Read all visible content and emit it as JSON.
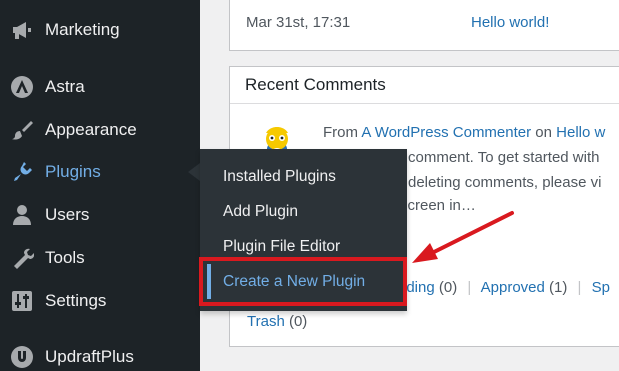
{
  "sidebar": {
    "items": [
      {
        "label": "Marketing",
        "icon": "megaphone-icon"
      },
      {
        "label": "Astra",
        "icon": "astra-logo-icon"
      },
      {
        "label": "Appearance",
        "icon": "paintbrush-icon"
      },
      {
        "label": "Plugins",
        "icon": "plugin-icon"
      },
      {
        "label": "Users",
        "icon": "user-icon"
      },
      {
        "label": "Tools",
        "icon": "wrench-icon"
      },
      {
        "label": "Settings",
        "icon": "settings-sliders-icon"
      },
      {
        "label": "UpdraftPlus",
        "icon": "updraftplus-icon"
      }
    ],
    "active_color": "#72aee6"
  },
  "activity": {
    "date": "Mar 31st, 17:31",
    "post_title": "Hello world!"
  },
  "recent_comments": {
    "title": "Recent Comments",
    "from_prefix": "From",
    "author": "A WordPress Commenter",
    "on_word": "on",
    "post": "Hello w",
    "line2": "comment. To get started with",
    "line3": "deleting comments, please vi",
    "line4": "screen in…",
    "status_links": {
      "pending": "nding",
      "pending_count": "(0)",
      "approved": "Approved",
      "approved_count": "(1)",
      "spam": "Sp",
      "trash": "Trash",
      "trash_count": "(0)"
    }
  },
  "plugins_submenu": {
    "items": [
      {
        "label": "Installed Plugins"
      },
      {
        "label": "Add Plugin"
      },
      {
        "label": "Plugin File Editor"
      },
      {
        "label": "Create a New Plugin"
      }
    ],
    "highlight_color": "#d9191f"
  }
}
